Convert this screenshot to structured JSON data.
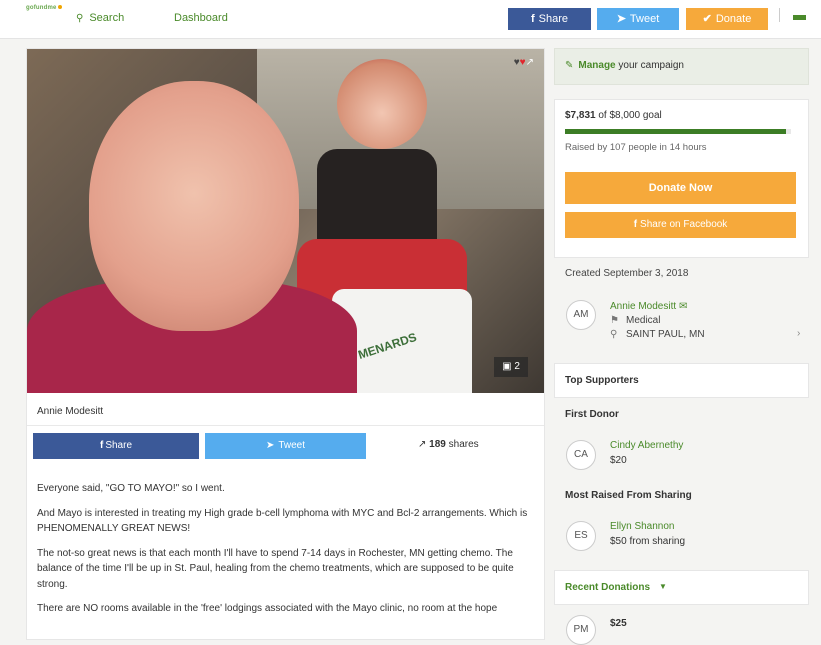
{
  "nav": {
    "logo_text": "gofundme",
    "search_label": "Search",
    "dashboard_label": "Dashboard",
    "share_label": "Share",
    "tweet_label": "Tweet",
    "donate_label": "Donate"
  },
  "campaign": {
    "photo_count": "2",
    "photo_label": "MENARDS",
    "organizer_name": "Annie Modesitt",
    "share_label": "Share",
    "tweet_label": "Tweet",
    "shares_count": "189",
    "shares_label": "shares",
    "story": [
      "Everyone said, \"GO TO MAYO!\" so I went.",
      "And Mayo is interested in treating my High grade b-cell lymphoma with MYC and Bcl-2 arrangements. Which is PHENOMENALLY GREAT NEWS!",
      "The not-so great news is that each month I'll have to spend 7-14 days in Rochester, MN getting chemo. The balance of the time I'll be up in St. Paul, healing from the chemo treatments, which are supposed to be quite strong.",
      "There are NO rooms available in the 'free' lodgings associated with the Mayo clinic, no room at the hope"
    ]
  },
  "sidebar": {
    "manage_bold": "Manage",
    "manage_rest": "your campaign",
    "raised_amount": "$7,831",
    "raised_of": "of $8,000 goal",
    "progress_fraction": 0.979,
    "raised_by": "Raised by 107 people in 14 hours",
    "donate_now": "Donate Now",
    "share_facebook": "Share on Facebook",
    "created": "Created September 3, 2018",
    "organizer": {
      "initials": "AM",
      "name": "Annie Modesitt",
      "category": "Medical",
      "location": "SAINT PAUL, MN"
    },
    "top_supporters": "Top Supporters",
    "first_donor_heading": "First Donor",
    "first_donor": {
      "initials": "CA",
      "name": "Cindy Abernethy",
      "amount": "$20"
    },
    "most_raised_heading": "Most Raised From Sharing",
    "most_raised": {
      "initials": "ES",
      "name": "Ellyn Shannon",
      "amount": "$50 from sharing"
    },
    "recent_donations": "Recent Donations",
    "recent": {
      "initials": "PM",
      "amount": "$25"
    }
  },
  "colors": {
    "brand_green": "#4a8a2a",
    "facebook_blue": "#3b5998",
    "twitter_blue": "#55acee",
    "donate_orange": "#f6a93b"
  }
}
